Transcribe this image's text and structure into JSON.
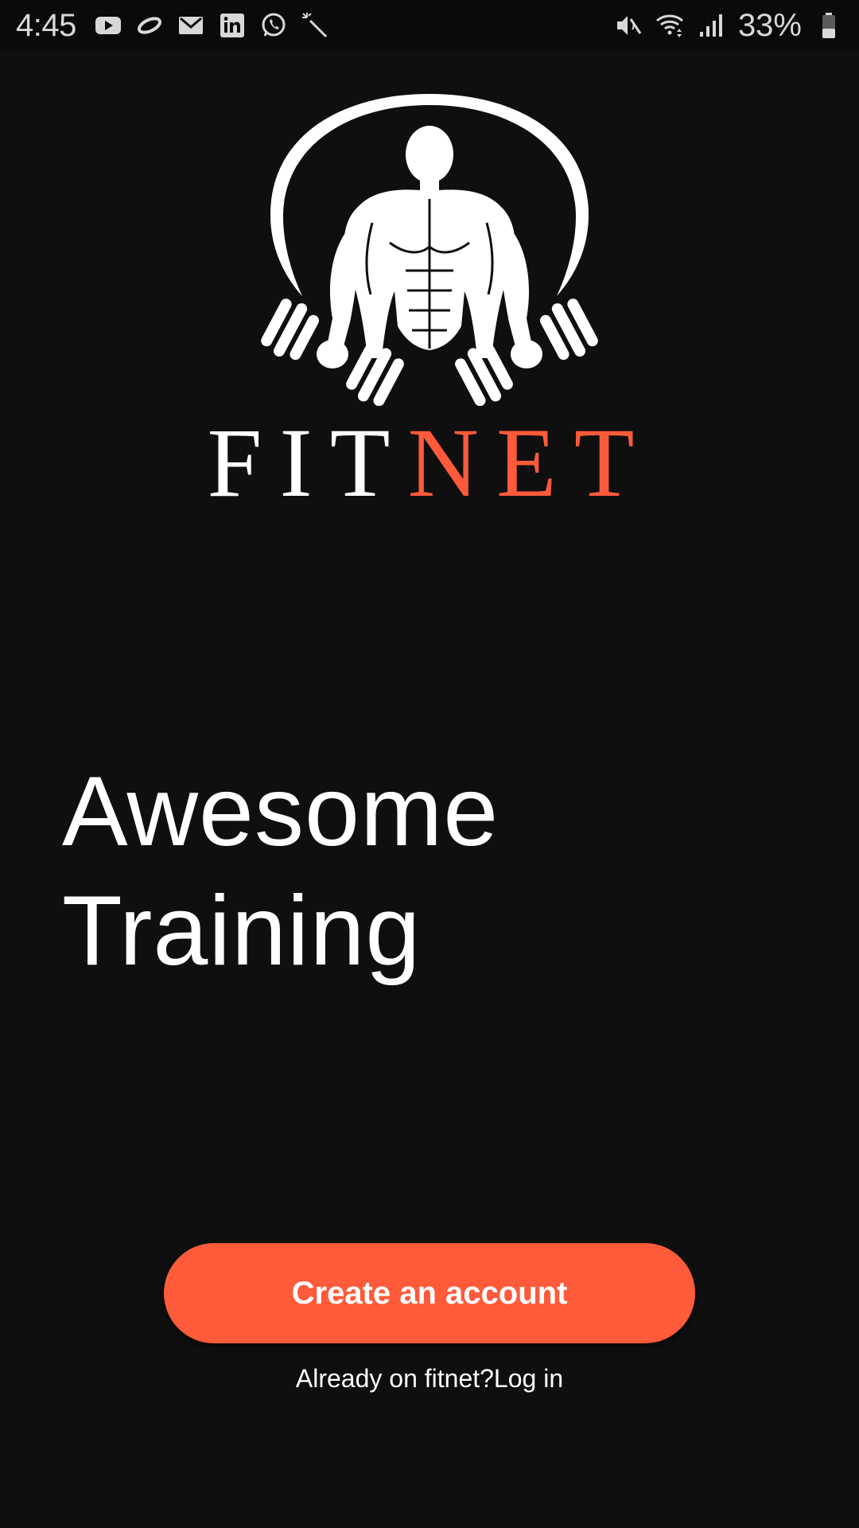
{
  "status_bar": {
    "time": "4:45",
    "left_icons": [
      "youtube-icon",
      "link-icon",
      "gmail-icon",
      "linkedin-icon",
      "whatsapp-icon",
      "magic-wand-icon"
    ],
    "right_icons": [
      "mute-icon",
      "wifi-icon",
      "signal-icon",
      "battery-icon"
    ],
    "battery_percent": "33%"
  },
  "logo": {
    "wordmark_part1": "FIT",
    "wordmark_part2": "NET"
  },
  "headline": {
    "line1": "Awesome",
    "line2": "Training"
  },
  "actions": {
    "create_account_label": "Create an account",
    "already_text": "Already on fitnet?",
    "login_label": "Log in"
  },
  "colors": {
    "background": "#0f0f0f",
    "accent": "#ff5a3a",
    "text": "#ffffff"
  }
}
